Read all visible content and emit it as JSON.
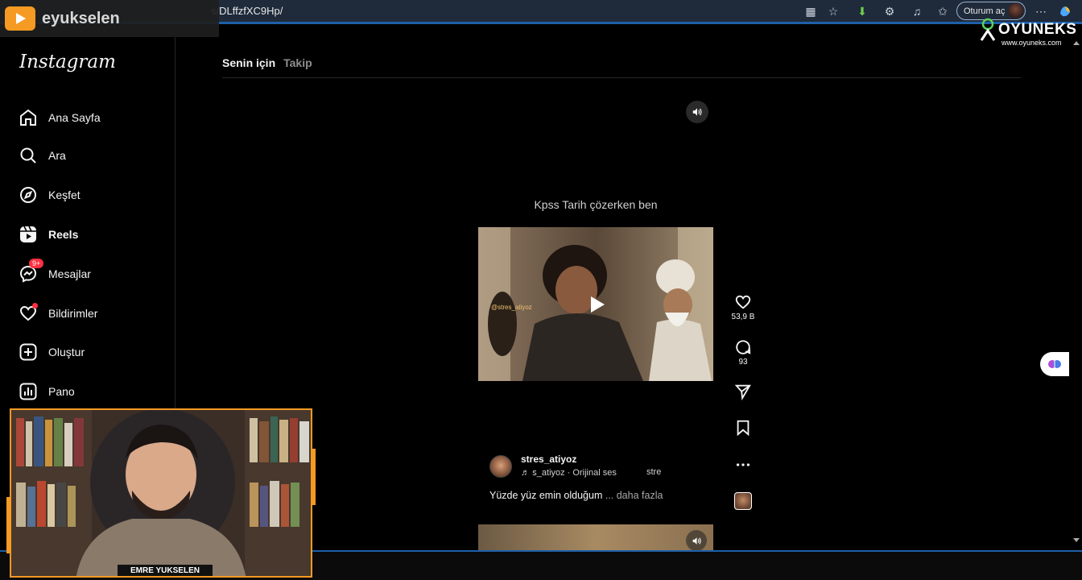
{
  "browser": {
    "url_fragment": "s/DLffzfXC9Hp/",
    "signin_label": "Oturum aç"
  },
  "stream": {
    "channel_name": "eyukselen",
    "sponsor_name": "OYUNEKS",
    "sponsor_url": "www.oyuneks.com",
    "webcam_name": "EMRE YUKSELEN"
  },
  "sidebar": {
    "brand": "Instagram",
    "items": [
      {
        "label": "Ana Sayfa",
        "icon": "home-icon"
      },
      {
        "label": "Ara",
        "icon": "search-icon"
      },
      {
        "label": "Keşfet",
        "icon": "explore-icon"
      },
      {
        "label": "Reels",
        "icon": "reels-icon",
        "active": true
      },
      {
        "label": "Mesajlar",
        "icon": "messenger-icon",
        "badge": "9+"
      },
      {
        "label": "Bildirimler",
        "icon": "heart-icon"
      },
      {
        "label": "Oluştur",
        "icon": "plus-square-icon"
      },
      {
        "label": "Pano",
        "icon": "dashboard-icon"
      }
    ]
  },
  "tabs": {
    "for_you": "Senin için",
    "following": "Takip"
  },
  "reel": {
    "caption_overlay": "Kpss Tarih çözerken ben",
    "watermark": "@stres_atiyoz",
    "likes": "53,9 B",
    "comments": "93",
    "author": "stres_atiyoz",
    "audio": "ꜱ_atiyoz · Orijinal ses",
    "audio_tail": "stre",
    "description": "Yüzde yüz emin olduğum",
    "more_label": "... daha fazla"
  }
}
